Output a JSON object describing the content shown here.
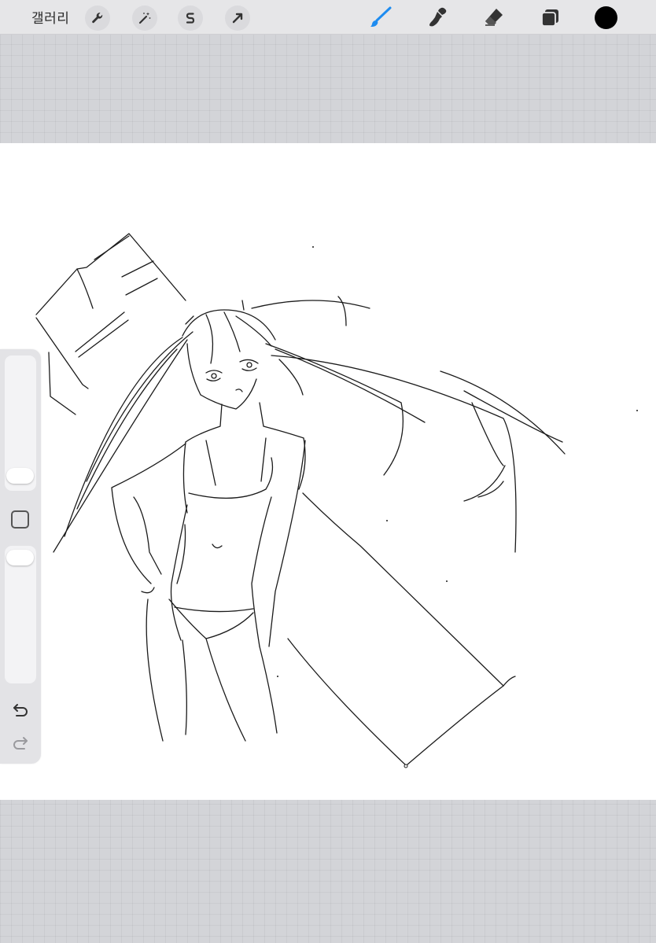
{
  "toolbar": {
    "gallery_label": "갤러리",
    "left_tools": [
      "wrench-icon",
      "magic-wand-icon",
      "selection-icon",
      "transform-arrow-icon"
    ],
    "right_tools": [
      "brush-icon",
      "smudge-icon",
      "eraser-icon",
      "layers-icon"
    ],
    "active_tool": "brush-icon",
    "active_color": "#1e8cf0",
    "current_color": "#000000"
  },
  "sidebar": {
    "brush_size_icon": "slider-thumb",
    "opacity_icon": "slider-thumb",
    "modify_icon": "square-icon",
    "undo_icon": "undo-arrow-icon",
    "redo_icon": "redo-arrow-icon"
  }
}
